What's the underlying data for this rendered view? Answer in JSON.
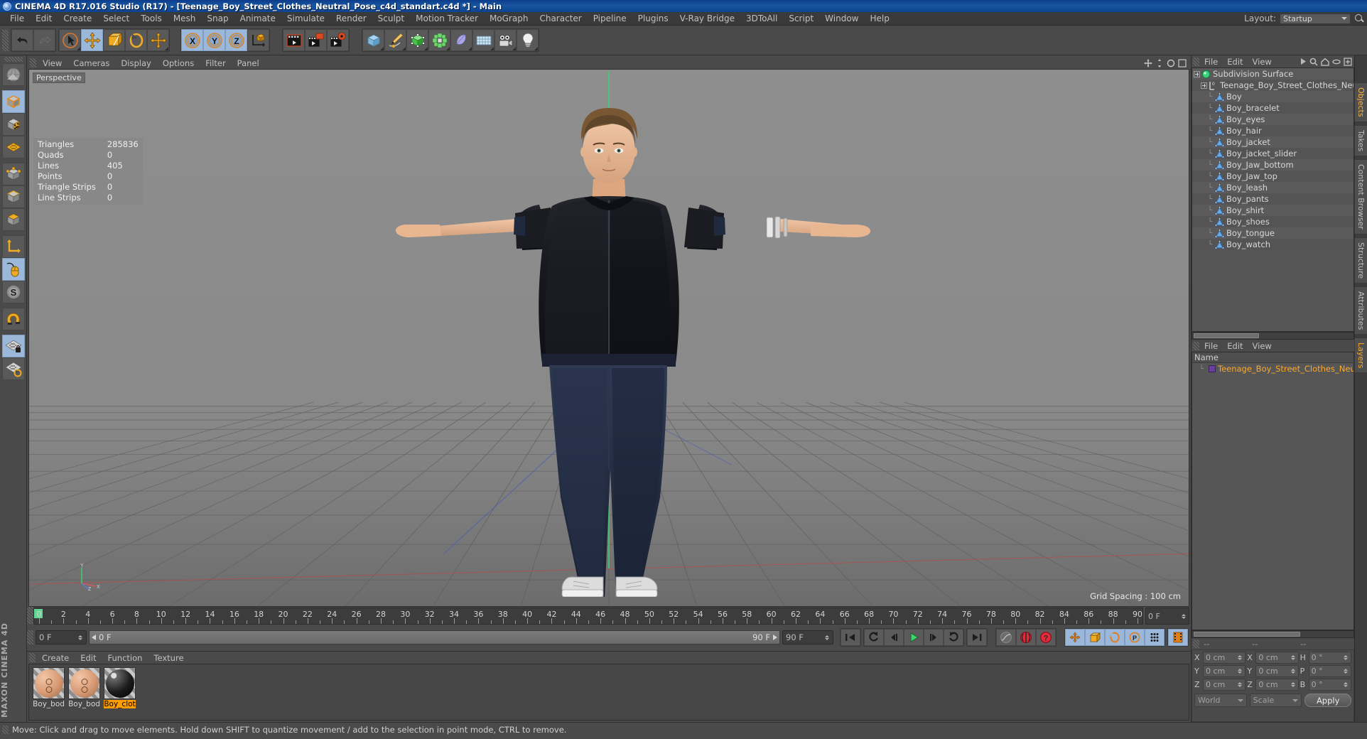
{
  "window": {
    "title": "CINEMA 4D R17.016 Studio (R17) - [Teenage_Boy_Street_Clothes_Neutral_Pose_c4d_standart.c4d *] - Main",
    "app_icon": "c4d-logo-icon"
  },
  "menubar": {
    "items": [
      "File",
      "Edit",
      "Create",
      "Select",
      "Tools",
      "Mesh",
      "Snap",
      "Animate",
      "Simulate",
      "Render",
      "Sculpt",
      "Motion Tracker",
      "MoGraph",
      "Character",
      "Pipeline",
      "Plugins",
      "V-Ray Bridge",
      "3DToAll",
      "Script",
      "Window",
      "Help"
    ],
    "layout_label": "Layout:",
    "layout_value": "Startup"
  },
  "toolbar": {
    "groups": [
      {
        "name": "undo-redo",
        "buttons": [
          {
            "icon": "undo-icon",
            "label": "Undo",
            "active": false
          },
          {
            "icon": "redo-icon",
            "label": "Redo",
            "active": false,
            "disabled": true
          }
        ]
      },
      {
        "name": "transform-tools",
        "buttons": [
          {
            "icon": "live-selection-icon",
            "label": "Live Selection",
            "active": false
          },
          {
            "icon": "move-icon",
            "label": "Move",
            "active": true
          },
          {
            "icon": "scale-icon",
            "label": "Scale",
            "active": false
          },
          {
            "icon": "rotate-icon",
            "label": "Rotate",
            "active": false
          },
          {
            "icon": "move-dup-icon",
            "label": "Move",
            "active": false
          }
        ]
      },
      {
        "name": "axis-locks",
        "buttons": [
          {
            "icon": "x-axis-icon",
            "label": "X",
            "active": true
          },
          {
            "icon": "y-axis-icon",
            "label": "Y",
            "active": true
          },
          {
            "icon": "z-axis-icon",
            "label": "Z",
            "active": true
          },
          {
            "icon": "world-object-axis-icon",
            "label": "World/Object",
            "active": false
          }
        ]
      },
      {
        "name": "render-tools",
        "buttons": [
          {
            "icon": "render-view-icon",
            "label": "Render View",
            "active": false
          },
          {
            "icon": "render-region-icon",
            "label": "Render to Picture Viewer",
            "active": false
          },
          {
            "icon": "render-settings-icon",
            "label": "Edit Render Settings",
            "active": false
          }
        ]
      },
      {
        "name": "create-objects",
        "buttons": [
          {
            "icon": "cube-primitive-icon",
            "label": "Add Cube Object",
            "active": false
          },
          {
            "icon": "spline-pen-icon",
            "label": "Add Spline",
            "active": false
          },
          {
            "icon": "generator-icon",
            "label": "Add Generator",
            "active": false
          },
          {
            "icon": "deformer-icon",
            "label": "Add Deformer",
            "active": false
          },
          {
            "icon": "scene-object-icon",
            "label": "Add Scene Object",
            "active": false
          },
          {
            "icon": "floor-object-icon",
            "label": "Add Environment",
            "active": false
          },
          {
            "icon": "camera-icon",
            "label": "Add Camera",
            "active": false
          },
          {
            "icon": "light-icon",
            "label": "Add Light",
            "active": false
          }
        ]
      }
    ]
  },
  "left_toolbar": {
    "buttons": [
      {
        "icon": "textured-mode-icon",
        "label": "Viewport Solo",
        "active": false
      },
      {
        "icon": "model-mode-icon",
        "label": "Model Mode",
        "active": true
      },
      {
        "icon": "texture-mode-icon",
        "label": "Texture Mode",
        "active": false
      },
      {
        "icon": "workplane-icon",
        "label": "Workplane",
        "active": false
      },
      {
        "icon": "point-mode-icon",
        "label": "Points Mode",
        "active": false
      },
      {
        "icon": "edge-mode-icon",
        "label": "Edges Mode",
        "active": false
      },
      {
        "icon": "polygon-mode-icon",
        "label": "Polygons Mode",
        "active": false
      },
      {
        "icon": "axis-mode-icon",
        "label": "Enable Axis Modification",
        "active": false
      },
      {
        "icon": "viewport-solo-mouse-icon",
        "label": "Enable Snapping",
        "active": true
      },
      {
        "icon": "soft-selection-icon",
        "label": "Soft Selection",
        "active": false
      },
      {
        "icon": "magnet-icon",
        "label": "Magnet",
        "active": false
      },
      {
        "icon": "workplane-lock-icon",
        "label": "Lock Workplane",
        "active": true
      },
      {
        "icon": "workplane-rotate-icon",
        "label": "Planar Workplane Rotation",
        "active": false
      }
    ],
    "brand": "MAXON CINEMA 4D"
  },
  "viewport": {
    "menu": [
      "View",
      "Cameras",
      "Display",
      "Options",
      "Filter",
      "Panel"
    ],
    "camera_label": "Perspective",
    "grid_spacing": "Grid Spacing : 100 cm",
    "stats": [
      {
        "label": "Triangles",
        "value": "285836"
      },
      {
        "label": "Quads",
        "value": "0"
      },
      {
        "label": "Lines",
        "value": "405"
      },
      {
        "label": "Points",
        "value": "0"
      },
      {
        "label": "Triangle Strips",
        "value": "0"
      },
      {
        "label": "Line Strips",
        "value": "0"
      }
    ],
    "axis_labels": {
      "y": "Y",
      "x": "X",
      "z": "Z"
    }
  },
  "timeline": {
    "tick_labels": [
      "0",
      "2",
      "4",
      "6",
      "8",
      "10",
      "12",
      "14",
      "16",
      "18",
      "20",
      "22",
      "24",
      "26",
      "28",
      "30",
      "32",
      "34",
      "36",
      "38",
      "40",
      "42",
      "44",
      "46",
      "48",
      "50",
      "52",
      "54",
      "56",
      "58",
      "60",
      "62",
      "64",
      "66",
      "68",
      "70",
      "72",
      "74",
      "76",
      "78",
      "80",
      "82",
      "84",
      "86",
      "88",
      "90"
    ],
    "frame_min": 0,
    "frame_max": 90,
    "current_frame_field": "0 F",
    "end_frame_field": "0 F",
    "range_start": "0 F",
    "range_end": "90 F",
    "preview_end_field": "90 F",
    "transport": [
      {
        "icon": "go-to-start-icon",
        "label": "Go to Start"
      },
      {
        "icon": "play-backwards-icon",
        "label": "Play Backwards"
      },
      {
        "icon": "previous-frame-icon",
        "label": "Go to Previous Frame"
      },
      {
        "icon": "play-forward-icon",
        "label": "Play Forward"
      },
      {
        "icon": "next-frame-icon",
        "label": "Go to Next Frame"
      },
      {
        "icon": "loop-icon",
        "label": "Loop Preview Range"
      },
      {
        "icon": "go-to-end-icon",
        "label": "Go to End"
      }
    ],
    "record_group": [
      {
        "icon": "autokey-curve-icon",
        "label": "Autokeying"
      },
      {
        "icon": "record-active-objects-icon",
        "label": "Record Active Objects"
      },
      {
        "icon": "keyframe-selection-icon",
        "label": "Keyframe Selection"
      }
    ],
    "key_toggles": [
      {
        "icon": "position-key-icon",
        "label": "Position",
        "active": true
      },
      {
        "icon": "scale-key-icon",
        "label": "Scale",
        "active": true
      },
      {
        "icon": "rotation-key-icon",
        "label": "Rotation",
        "active": true
      },
      {
        "icon": "param-key-icon",
        "label": "Parameter",
        "active": true
      },
      {
        "icon": "pla-key-icon",
        "label": "Point Level Animation",
        "active": true
      },
      {
        "icon": "timeline-panel-icon",
        "label": "Timeline",
        "active": true
      }
    ]
  },
  "material_manager": {
    "menu": [
      "Create",
      "Edit",
      "Function",
      "Texture"
    ],
    "materials": [
      {
        "name": "Boy_bod",
        "preview": "skin-sphere-icon",
        "selected": false
      },
      {
        "name": "Boy_bod",
        "preview": "skin-sphere-icon",
        "selected": false
      },
      {
        "name": "Boy_clot",
        "preview": "cloth-sphere-icon",
        "selected": true
      }
    ]
  },
  "object_manager": {
    "menu": [
      "File",
      "Edit",
      "View"
    ],
    "header_icons": [
      "play-arrow-icon",
      "search-icon",
      "home-icon",
      "ellipse-icon",
      "add-layer-icon"
    ],
    "items": [
      {
        "label": "Subdivision Surface",
        "depth": 0,
        "icon": "subdivision-surface-icon",
        "expandable": true
      },
      {
        "label": "Teenage_Boy_Street_Clothes_Neu",
        "depth": 1,
        "icon": "null-object-icon",
        "expandable": true
      },
      {
        "label": "Boy",
        "depth": 2,
        "icon": "polygon-object-icon",
        "expandable": false
      },
      {
        "label": "Boy_bracelet",
        "depth": 2,
        "icon": "polygon-object-icon",
        "expandable": false
      },
      {
        "label": "Boy_eyes",
        "depth": 2,
        "icon": "polygon-object-icon",
        "expandable": false
      },
      {
        "label": "Boy_hair",
        "depth": 2,
        "icon": "polygon-object-icon",
        "expandable": false
      },
      {
        "label": "Boy_jacket",
        "depth": 2,
        "icon": "polygon-object-icon",
        "expandable": false
      },
      {
        "label": "Boy_jacket_slider",
        "depth": 2,
        "icon": "polygon-object-icon",
        "expandable": false
      },
      {
        "label": "Boy_Jaw_bottom",
        "depth": 2,
        "icon": "polygon-object-icon",
        "expandable": false
      },
      {
        "label": "Boy_Jaw_top",
        "depth": 2,
        "icon": "polygon-object-icon",
        "expandable": false
      },
      {
        "label": "Boy_leash",
        "depth": 2,
        "icon": "polygon-object-icon",
        "expandable": false
      },
      {
        "label": "Boy_pants",
        "depth": 2,
        "icon": "polygon-object-icon",
        "expandable": false
      },
      {
        "label": "Boy_shirt",
        "depth": 2,
        "icon": "polygon-object-icon",
        "expandable": false
      },
      {
        "label": "Boy_shoes",
        "depth": 2,
        "icon": "polygon-object-icon",
        "expandable": false
      },
      {
        "label": "Boy_tongue",
        "depth": 2,
        "icon": "polygon-object-icon",
        "expandable": false
      },
      {
        "label": "Boy_watch",
        "depth": 2,
        "icon": "polygon-object-icon",
        "expandable": false
      }
    ]
  },
  "layer_manager": {
    "menu": [
      "File",
      "Edit",
      "View"
    ],
    "column_header": "Name",
    "rows": [
      {
        "label": "Teenage_Boy_Street_Clothes_Neut",
        "color": "#6b3fa0"
      }
    ]
  },
  "coordinates": {
    "headers": [
      "--",
      "--",
      "--"
    ],
    "position": {
      "label_x": "X",
      "x": "0 cm",
      "label_y": "Y",
      "y": "0 cm",
      "label_z": "Z",
      "z": "0 cm"
    },
    "size": {
      "label_x": "X",
      "x": "0 cm",
      "label_y": "Y",
      "y": "0 cm",
      "label_z": "Z",
      "z": "0 cm"
    },
    "rotation": {
      "label_h": "H",
      "h": "0 °",
      "label_p": "P",
      "p": "0 °",
      "label_b": "B",
      "b": "0 °"
    },
    "coord_system": "World",
    "mode": "Scale",
    "apply_label": "Apply"
  },
  "right_tabs": [
    {
      "label": "Objects",
      "active": true
    },
    {
      "label": "Takes",
      "active": false
    },
    {
      "label": "Content Browser",
      "active": false
    },
    {
      "label": "Structure",
      "active": false
    },
    {
      "label": "Attributes",
      "active": false
    },
    {
      "label": "Layers",
      "active": true
    }
  ],
  "status_bar": {
    "message": "Move: Click and drag to move elements. Hold down SHIFT to quantize movement / add to the selection in point mode, CTRL to remove."
  },
  "colors": {
    "accent_orange": "#ffa827",
    "panel_bg": "#4a4a4a",
    "list_bg": "#565656",
    "active_blue": "#9bb8da",
    "title_blue": "#19559f",
    "playhead_green": "#62d694"
  }
}
